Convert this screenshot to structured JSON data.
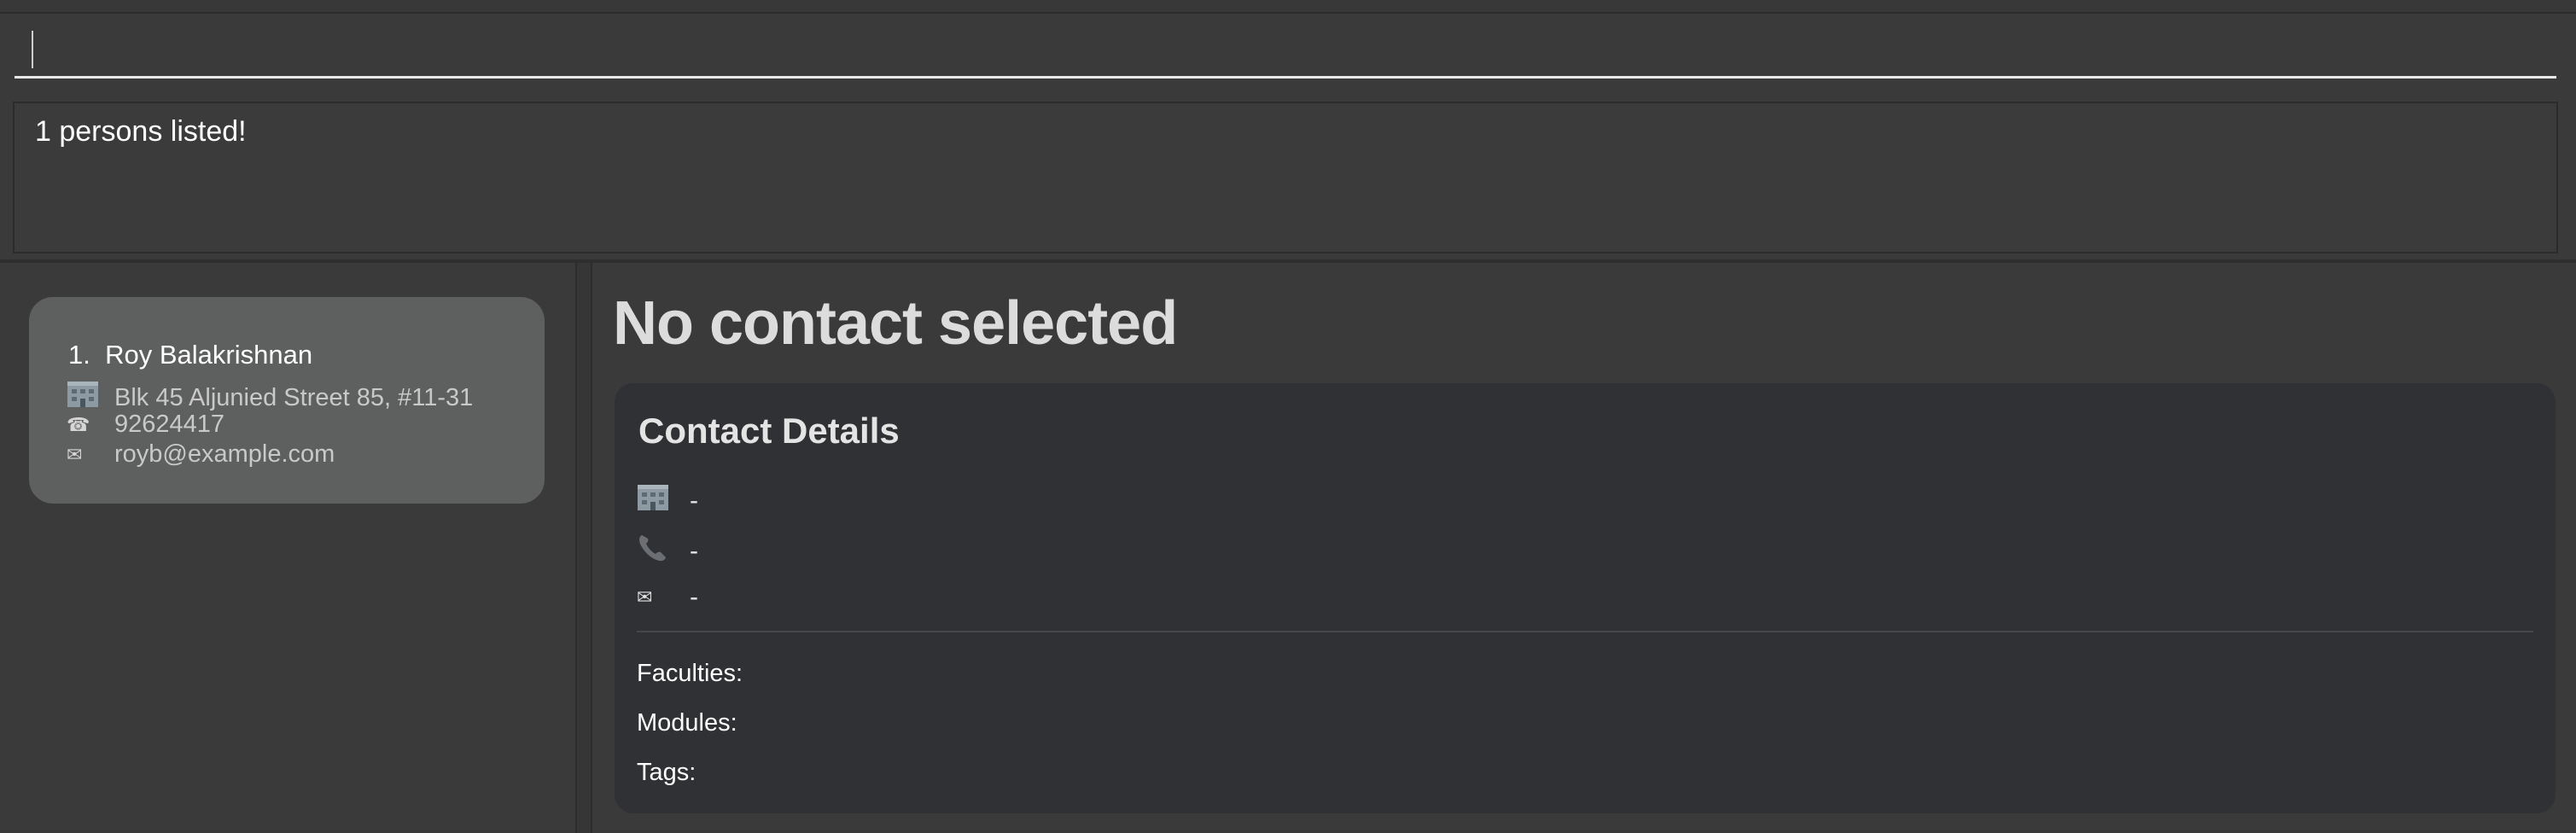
{
  "command": {
    "value": ""
  },
  "result": {
    "message": "1 persons listed!"
  },
  "person_list": {
    "items": [
      {
        "index": "1.",
        "name": "Roy Balakrishnan",
        "address": "Blk 45 Aljunied Street 85, #11-31",
        "phone": "92624417",
        "email": "royb@example.com"
      }
    ]
  },
  "detail": {
    "title": "No contact selected",
    "card_heading": "Contact Details",
    "address": "-",
    "phone": "-",
    "email": "-",
    "faculties_label": "Faculties:",
    "modules_label": "Modules:",
    "tags_label": "Tags:"
  },
  "icons": {
    "address": "building-icon",
    "phone": "phone-icon",
    "email": "envelope-icon"
  },
  "colors": {
    "background": "#3a3a3a",
    "card": "#5e5f5f",
    "details_card": "#2f3135"
  }
}
